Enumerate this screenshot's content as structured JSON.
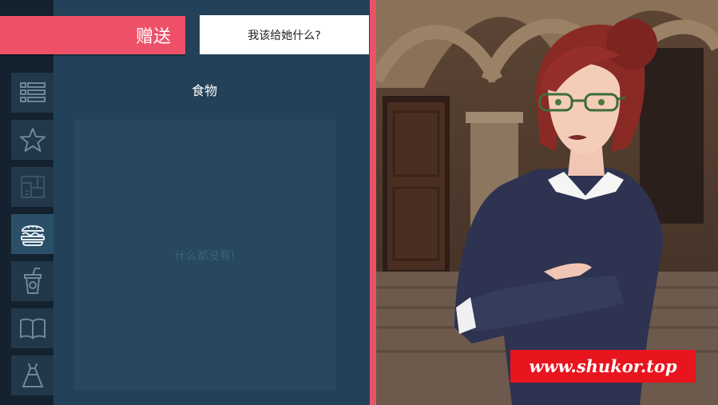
{
  "gift_tab": {
    "label": "赠送"
  },
  "prompt": {
    "question": "我该给她什么?"
  },
  "category": {
    "title": "食物"
  },
  "items": {
    "empty_message": "什么都没有!"
  },
  "sidebar": {
    "buttons": [
      {
        "name": "list-icon"
      },
      {
        "name": "star-icon"
      },
      {
        "name": "blueprint-icon"
      },
      {
        "name": "burger-icon",
        "active": true
      },
      {
        "name": "drink-icon"
      },
      {
        "name": "book-icon"
      },
      {
        "name": "dress-icon"
      }
    ]
  },
  "watermark": {
    "text": "www.shukor.top"
  },
  "colors": {
    "accent": "#ee5068",
    "panel": "#234259",
    "rail": "#13222e",
    "close_x": "#e9536a",
    "watermark_bg": "#e8141e"
  }
}
